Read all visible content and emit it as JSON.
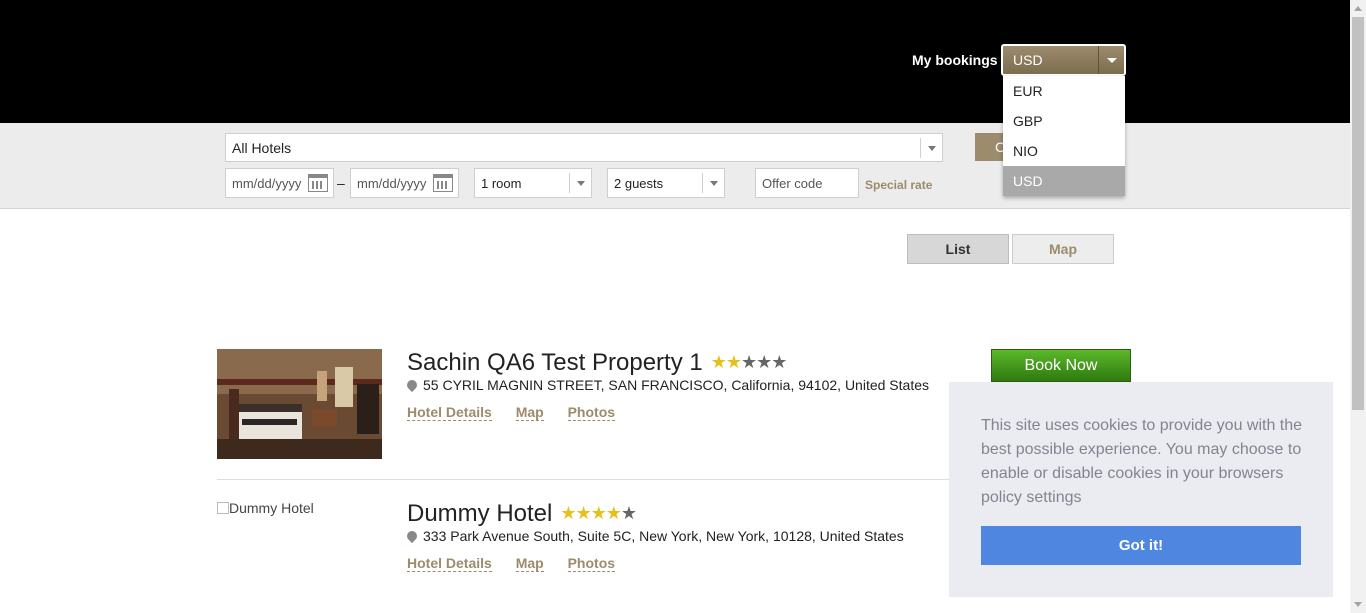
{
  "header": {
    "my_bookings": "My bookings",
    "currency_selected": "USD",
    "currency_options": [
      "EUR",
      "GBP",
      "NIO",
      "USD"
    ]
  },
  "search": {
    "hotel_select": "All Hotels",
    "check_button": "C",
    "checkin_placeholder": "mm/dd/yyyy",
    "checkout_placeholder": "mm/dd/yyyy",
    "date_separator": "–",
    "rooms": "1 room",
    "guests": "2 guests",
    "offer_placeholder": "Offer code",
    "special_rate": "Special rate"
  },
  "view_toggle": {
    "list": "List",
    "map": "Map"
  },
  "hotels": [
    {
      "name": "Sachin QA6 Test Property 1",
      "stars": 2,
      "address": "55 CYRIL MAGNIN STREET, SAN FRANCISCO, California, 94102, United States",
      "links": [
        "Hotel Details",
        "Map",
        "Photos"
      ],
      "book_label": "Book Now"
    },
    {
      "name": "Dummy Hotel",
      "stars": 4,
      "image_alt": "Dummy Hotel",
      "address": "333 Park Avenue South, Suite 5C, New York, New York, 10128, United States",
      "links": [
        "Hotel Details",
        "Map",
        "Photos"
      ]
    }
  ],
  "cookie": {
    "message": "This site uses cookies to provide you with the best possible experience. You may choose to enable or disable cookies in your browsers policy settings",
    "button": "Got it!"
  }
}
